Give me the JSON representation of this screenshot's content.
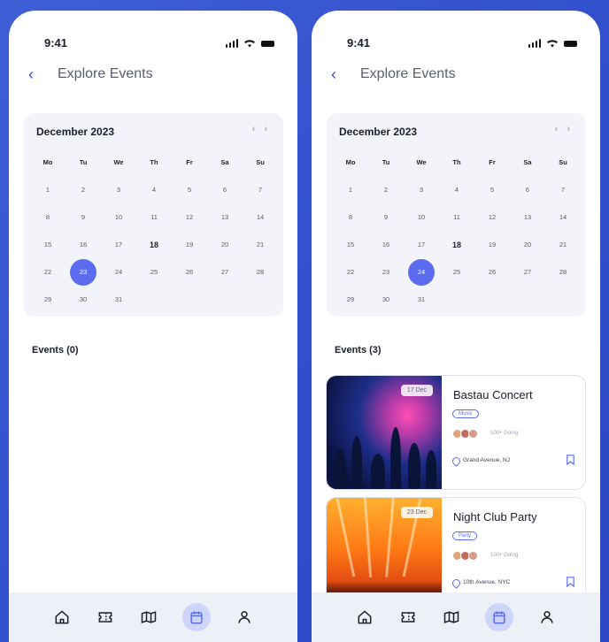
{
  "phones": [
    {
      "status_time": "9:41",
      "header": {
        "back_icon": "‹",
        "title": "Explore Events"
      },
      "calendar": {
        "month": "December 2023",
        "weekdays": [
          "Mo",
          "Tu",
          "We",
          "Th",
          "Fr",
          "Sa",
          "Su"
        ],
        "days": [
          "1",
          "2",
          "3",
          "4",
          "5",
          "6",
          "7",
          "8",
          "9",
          "10",
          "11",
          "12",
          "13",
          "14",
          "15",
          "16",
          "17",
          "18",
          "19",
          "20",
          "21",
          "22",
          "23",
          "24",
          "25",
          "26",
          "27",
          "28",
          "29",
          "30",
          "31"
        ],
        "selected_day": "23"
      },
      "events_heading": "Events (0)",
      "events": []
    },
    {
      "status_time": "9:41",
      "header": {
        "back_icon": "‹",
        "title": "Explore Events"
      },
      "calendar": {
        "month": "December 2023",
        "weekdays": [
          "Mo",
          "Tu",
          "We",
          "Th",
          "Fr",
          "Sa",
          "Su"
        ],
        "days": [
          "1",
          "2",
          "3",
          "4",
          "5",
          "6",
          "7",
          "8",
          "9",
          "10",
          "11",
          "12",
          "13",
          "14",
          "15",
          "16",
          "17",
          "18",
          "19",
          "20",
          "21",
          "22",
          "23",
          "24",
          "25",
          "26",
          "27",
          "28",
          "29",
          "30",
          "31"
        ],
        "selected_day": "24"
      },
      "events_heading": "Events (3)",
      "events": [
        {
          "date_badge": "17 Dec",
          "title": "Bastau Concert",
          "tag": "Music",
          "going": "100+ Going",
          "location": "Grand Avenue, NJ"
        },
        {
          "date_badge": "23 Dec",
          "title": "Night Club Party",
          "tag": "Party",
          "going": "100+ Going",
          "location": "10th Avenue, NYC"
        }
      ]
    }
  ],
  "tabbar": {
    "icons": [
      "home-icon",
      "ticket-icon",
      "map-icon",
      "calendar-icon",
      "profile-icon"
    ],
    "active": "calendar-icon"
  },
  "colors": {
    "accent": "#5b6cf0",
    "background": "#3250cc",
    "selected_tab_bg": "#cdd5fb"
  }
}
